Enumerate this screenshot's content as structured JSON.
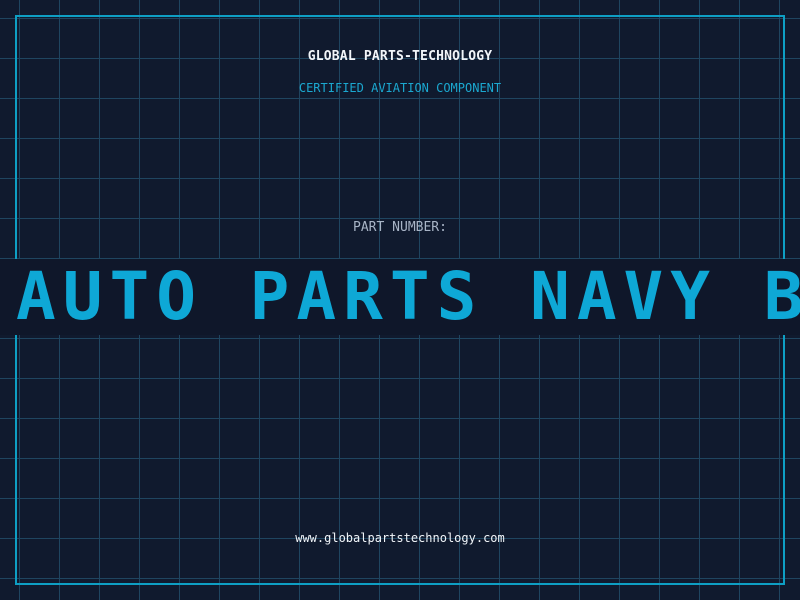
{
  "company_name": "GLOBAL PARTS-TECHNOLOGY",
  "certification": "CERTIFIED AVIATION COMPONENT",
  "part_number_label": "PART NUMBER:",
  "part_number_value": "AUTO PARTS NAVY BO",
  "website": "www.globalpartstechnology.com",
  "colors": {
    "background": "#101a2e",
    "grid": "#1f4560",
    "accent": "#0ea8d6",
    "text": "#f1f5f9",
    "muted": "#a8b4c6"
  }
}
